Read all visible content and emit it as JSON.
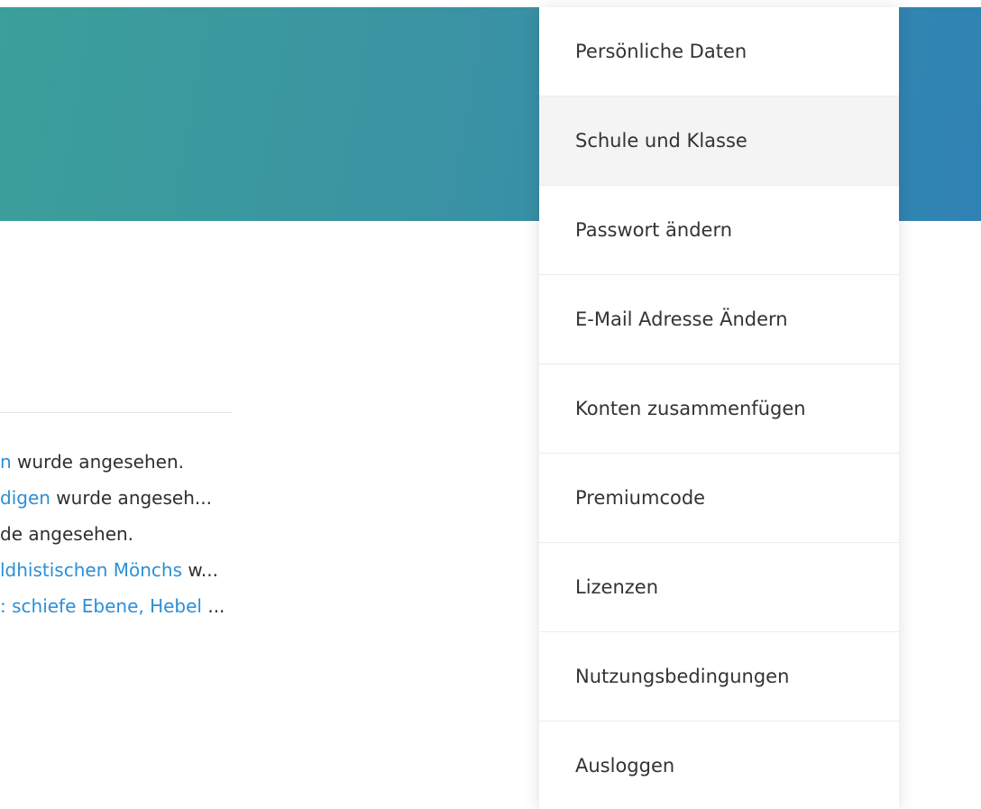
{
  "colors": {
    "banner_start": "#3b9f9a",
    "banner_end": "#2f82b4",
    "link": "#2b8fd6",
    "text": "#333333",
    "hover_bg": "#f4f4f4"
  },
  "activity": [
    {
      "link": "n",
      "suffix": " wurde angesehen."
    },
    {
      "link": "digen",
      "suffix": " wurde angeseh..."
    },
    {
      "link": "",
      "suffix": "de angesehen."
    },
    {
      "link": "ldhistischen Mönchs",
      "suffix": " w..."
    },
    {
      "link": ": schiefe Ebene, Hebel",
      "suffix": " ..."
    }
  ],
  "menu": {
    "items": [
      {
        "label": "Persönliche Daten"
      },
      {
        "label": "Schule und Klasse",
        "hovered": true
      },
      {
        "label": "Passwort ändern"
      },
      {
        "label": "E-Mail Adresse Ändern"
      },
      {
        "label": "Konten zusammenfügen"
      },
      {
        "label": "Premiumcode"
      },
      {
        "label": "Lizenzen"
      },
      {
        "label": "Nutzungsbedingungen"
      },
      {
        "label": "Ausloggen"
      }
    ]
  }
}
